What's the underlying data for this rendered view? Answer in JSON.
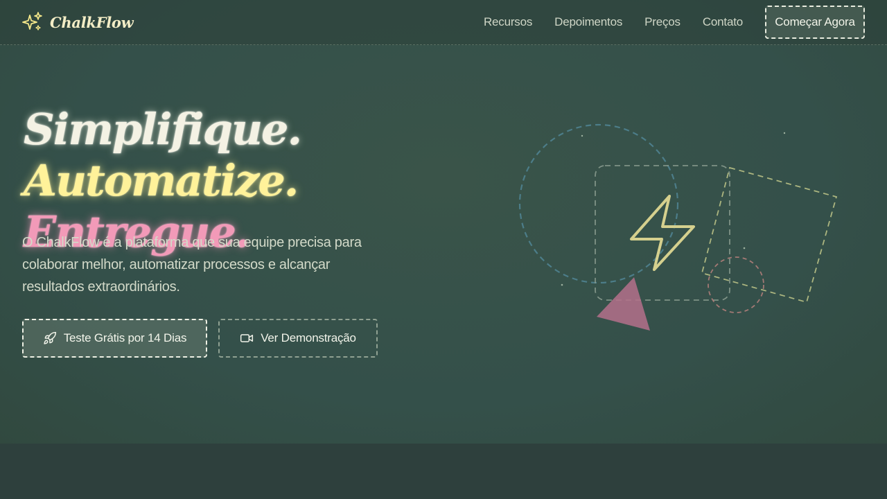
{
  "brand": {
    "name": "ChalkFlow",
    "icon": "sparkles-icon"
  },
  "nav": {
    "links": [
      "Recursos",
      "Depoimentos",
      "Preços",
      "Contato"
    ],
    "cta_label": "Começar Agora"
  },
  "hero": {
    "headline_part1": "Simplifique.",
    "headline_part2": "Automatize.",
    "headline_part3": "Entregue.",
    "subtitle": "O ChalkFlow é a plataforma que sua equipe precisa para colaborar melhor, automatizar processos e alcançar resultados extraordinários.",
    "primary_button": {
      "label": "Teste Grátis por 14 Dias",
      "icon": "rocket-icon"
    },
    "secondary_button": {
      "label": "Ver Demonstração",
      "icon": "video-camera-icon"
    }
  },
  "colors": {
    "background": "#34504a",
    "accent_yellow": "#fff29a",
    "accent_pink": "#f29ab8",
    "text": "#d3dac9"
  }
}
